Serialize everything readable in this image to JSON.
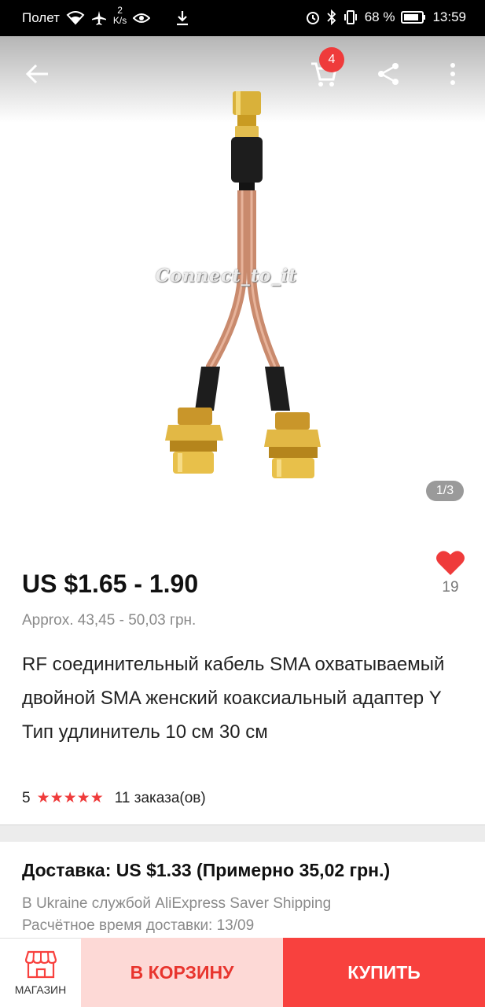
{
  "status_bar": {
    "carrier": "Полет",
    "speed_value": "2",
    "speed_unit": "K/s",
    "battery": "68 %",
    "time": "13:59"
  },
  "header": {
    "cart_count": "4",
    "image_counter": "1/3",
    "watermark": "Connect_to_it"
  },
  "product": {
    "price": "US $1.65 - 1.90",
    "approx_price": "Approx. 43,45 - 50,03 грн.",
    "wish_count": "19",
    "title": "RF соединительный кабель SMA охватываемый двойной SMA женский коаксиальный адаптер Y Тип удлинитель 10 см 30 см",
    "rating": "5",
    "stars": "★★★★★",
    "orders": "11 заказа(ов)"
  },
  "delivery": {
    "title": "Доставка: US $1.33 (Примерно 35,02 грн.)",
    "method": "В Ukraine службой AliExpress Saver Shipping",
    "eta": "Расчётное время доставки: 13/09"
  },
  "bottom_bar": {
    "shop_label": "МАГАЗИН",
    "add_to_cart": "В КОРЗИНУ",
    "buy": "КУПИТЬ"
  },
  "colors": {
    "accent": "#f8413e",
    "cart_button_bg": "#fdd9d6",
    "heart": "#ef3b3b"
  }
}
